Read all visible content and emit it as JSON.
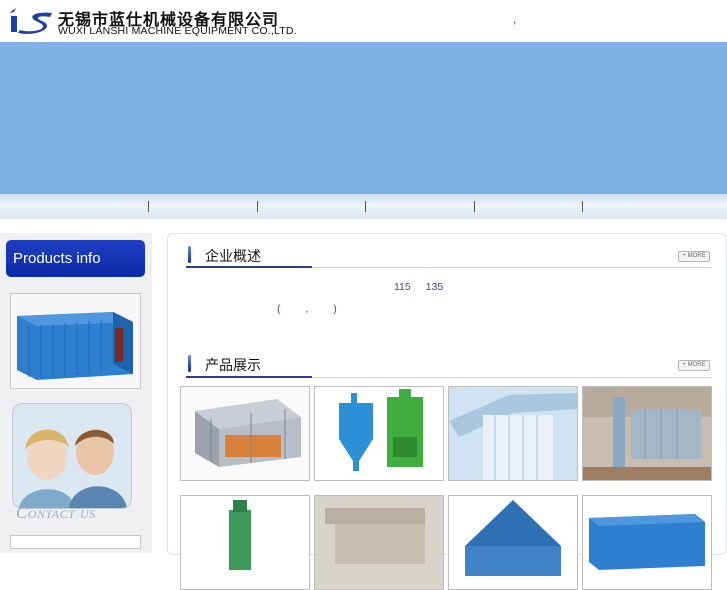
{
  "header": {
    "company_cn": "无锡市蓝仕机械设备有限公司",
    "company_en": "WUXI LANSHI MACHINE EQUIPMENT CO.,LTD.",
    "stray_comma": ","
  },
  "colors": {
    "banner": "#7fb3e8",
    "brand_blue": "#0b2aa8",
    "accent_line": "#2a3d8f"
  },
  "nav": {
    "separators": [
      "|",
      "|",
      "|",
      "|",
      "|"
    ]
  },
  "sidebar": {
    "products_title": "Products info",
    "contact_label": "Contact us"
  },
  "overview": {
    "title": "企业概述",
    "more_label": "+ MORE",
    "numbers": "115 135",
    "paren_text": "( , )"
  },
  "products": {
    "title": "产品展示",
    "more_label": "+ MORE",
    "items": [
      {
        "icon": "dryer-machine-photo"
      },
      {
        "icon": "cyclone-dust-collector-photo"
      },
      {
        "icon": "bag-filter-housing-photo"
      },
      {
        "icon": "industrial-silo-photo"
      },
      {
        "icon": "green-separator-photo"
      },
      {
        "icon": "factory-ducting-photo"
      },
      {
        "icon": "hopper-roof-photo"
      },
      {
        "icon": "blue-container-filter-photo"
      }
    ]
  }
}
